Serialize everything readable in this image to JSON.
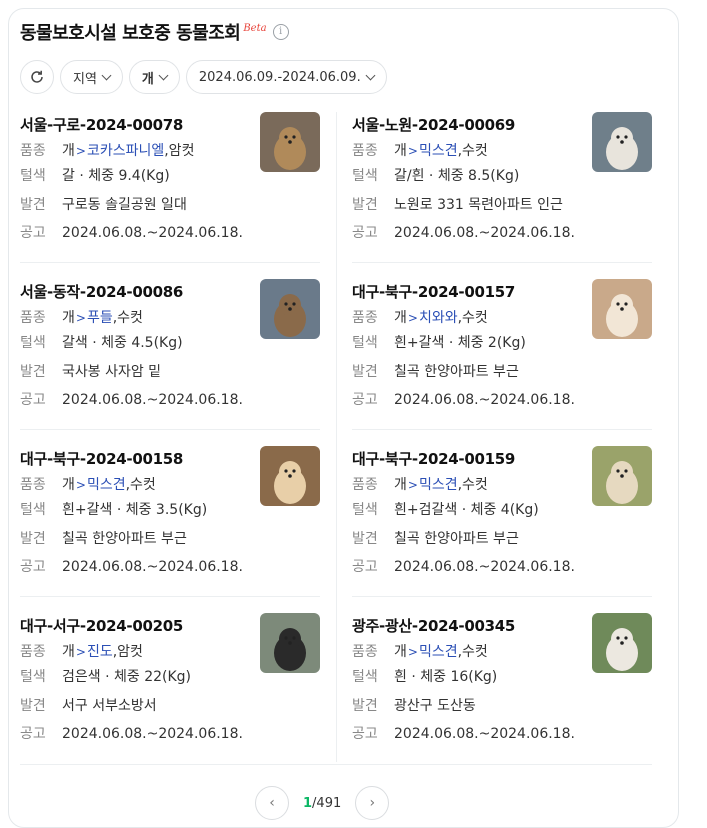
{
  "header": {
    "title": "동물보호시설 보호중 동물조회",
    "beta": "Beta",
    "info_icon": "info-icon"
  },
  "filters": {
    "refresh_icon": "refresh-icon",
    "region": "지역",
    "species": "개",
    "date_range": "2024.06.09.-2024.06.09."
  },
  "labels": {
    "breed": "품종",
    "color": "털색",
    "found": "발견",
    "notice": "공고"
  },
  "animals": [
    {
      "id": "서울-구로-2024-00078",
      "species": "개",
      "breed": "코카스파니엘",
      "sex": ",암컷",
      "color_weight": "갈 · 체중 9.4(Kg)",
      "found": "구로동 솔길공원 일대",
      "notice": "2024.06.08.~2024.06.18."
    },
    {
      "id": "서울-노원-2024-00069",
      "species": "개",
      "breed": "믹스견",
      "sex": ",수컷",
      "color_weight": "갈/흰 · 체중 8.5(Kg)",
      "found": "노원로 331 목련아파트 인근",
      "notice": "2024.06.08.~2024.06.18."
    },
    {
      "id": "서울-동작-2024-00086",
      "species": "개",
      "breed": "푸들",
      "sex": ",수컷",
      "color_weight": "갈색 · 체중 4.5(Kg)",
      "found": "국사봉 사자암 밑",
      "notice": "2024.06.08.~2024.06.18."
    },
    {
      "id": "대구-북구-2024-00157",
      "species": "개",
      "breed": "치와와",
      "sex": ",수컷",
      "color_weight": "흰+갈색 · 체중 2(Kg)",
      "found": "칠곡 한양아파트 부근",
      "notice": "2024.06.08.~2024.06.18."
    },
    {
      "id": "대구-북구-2024-00158",
      "species": "개",
      "breed": "믹스견",
      "sex": ",수컷",
      "color_weight": "흰+갈색 · 체중 3.5(Kg)",
      "found": "칠곡 한양아파트 부근",
      "notice": "2024.06.08.~2024.06.18."
    },
    {
      "id": "대구-북구-2024-00159",
      "species": "개",
      "breed": "믹스견",
      "sex": ",수컷",
      "color_weight": "흰+검갈색 · 체중 4(Kg)",
      "found": "칠곡 한양아파트 부근",
      "notice": "2024.06.08.~2024.06.18."
    },
    {
      "id": "대구-서구-2024-00205",
      "species": "개",
      "breed": "진도",
      "sex": ",암컷",
      "color_weight": "검은색 · 체중 22(Kg)",
      "found": "서구 서부소방서",
      "notice": "2024.06.08.~2024.06.18."
    },
    {
      "id": "광주-광산-2024-00345",
      "species": "개",
      "breed": "믹스견",
      "sex": ",수컷",
      "color_weight": "흰 · 체중 16(Kg)",
      "found": "광산구 도산동",
      "notice": "2024.06.08.~2024.06.18."
    }
  ],
  "pagination": {
    "current": "1",
    "total": "/491"
  }
}
